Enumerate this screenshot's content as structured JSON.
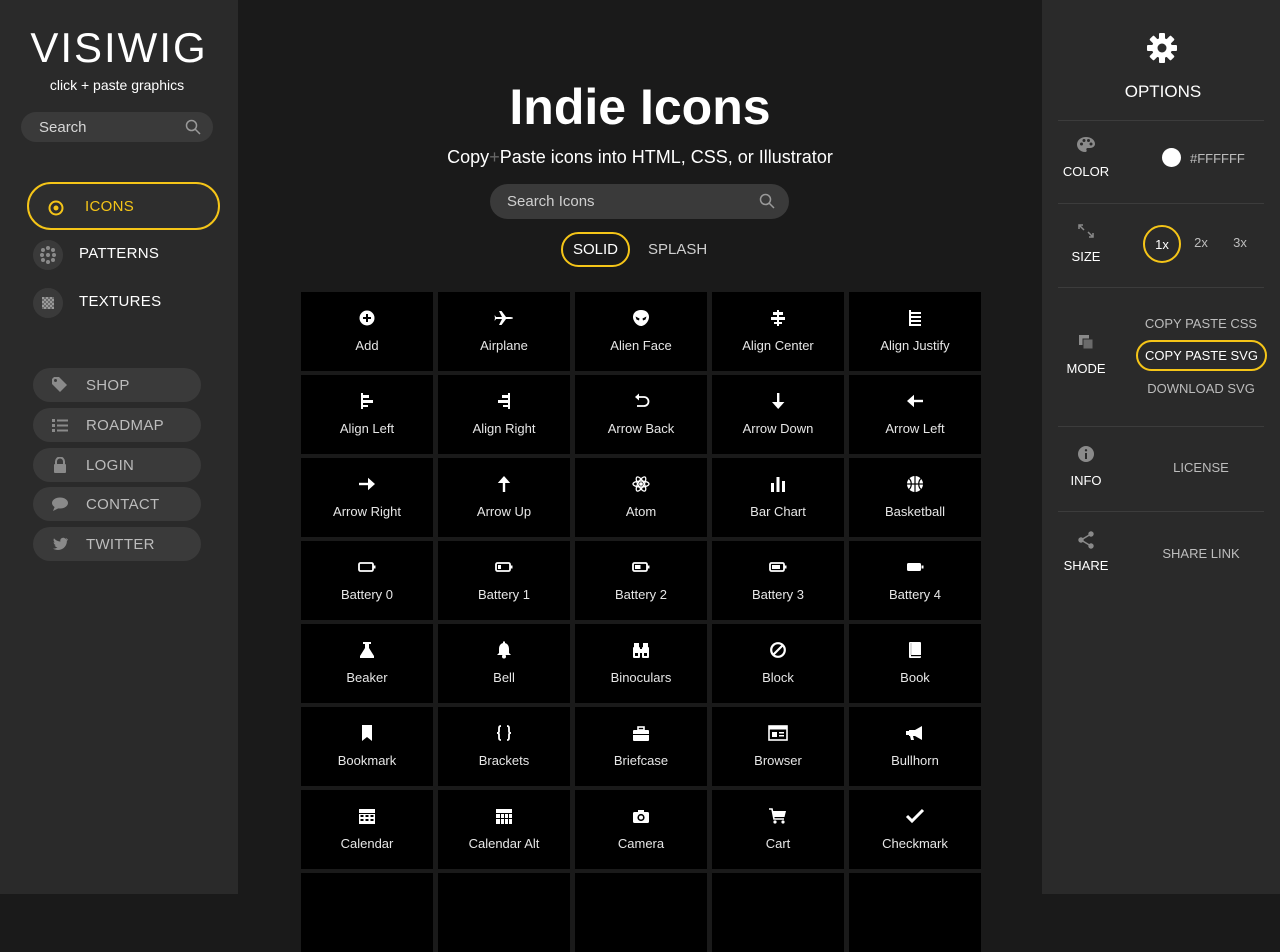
{
  "sidebar": {
    "logo": "VISIWIG",
    "tagline": "click + paste graphics",
    "search_placeholder": "Search",
    "nav": [
      {
        "label": "ICONS",
        "active": true
      },
      {
        "label": "PATTERNS",
        "active": false
      },
      {
        "label": "TEXTURES",
        "active": false
      }
    ],
    "links": [
      {
        "label": "SHOP",
        "icon": "tag-icon"
      },
      {
        "label": "ROADMAP",
        "icon": "list-icon"
      },
      {
        "label": "LOGIN",
        "icon": "lock-icon"
      },
      {
        "label": "CONTACT",
        "icon": "chat-icon"
      },
      {
        "label": "TWITTER",
        "icon": "twitter-icon"
      }
    ]
  },
  "main": {
    "title": "Indie Icons",
    "subtitle_pre": "Copy",
    "subtitle_plus": "+",
    "subtitle_post": "Paste icons into HTML, CSS, or Illustrator",
    "search_placeholder": "Search Icons",
    "tabs": [
      {
        "label": "SOLID",
        "active": true
      },
      {
        "label": "SPLASH",
        "active": false
      }
    ],
    "icons": [
      {
        "label": "Add",
        "icon": "plus-circle-icon"
      },
      {
        "label": "Airplane",
        "icon": "airplane-icon"
      },
      {
        "label": "Alien Face",
        "icon": "alien-face-icon"
      },
      {
        "label": "Align Center",
        "icon": "align-center-icon"
      },
      {
        "label": "Align Justify",
        "icon": "align-justify-icon"
      },
      {
        "label": "Align Left",
        "icon": "align-left-icon"
      },
      {
        "label": "Align Right",
        "icon": "align-right-icon"
      },
      {
        "label": "Arrow Back",
        "icon": "arrow-back-icon"
      },
      {
        "label": "Arrow Down",
        "icon": "arrow-down-icon"
      },
      {
        "label": "Arrow Left",
        "icon": "arrow-left-icon"
      },
      {
        "label": "Arrow Right",
        "icon": "arrow-right-icon"
      },
      {
        "label": "Arrow Up",
        "icon": "arrow-up-icon"
      },
      {
        "label": "Atom",
        "icon": "atom-icon"
      },
      {
        "label": "Bar Chart",
        "icon": "bar-chart-icon"
      },
      {
        "label": "Basketball",
        "icon": "basketball-icon"
      },
      {
        "label": "Battery 0",
        "icon": "battery-0-icon"
      },
      {
        "label": "Battery 1",
        "icon": "battery-1-icon"
      },
      {
        "label": "Battery 2",
        "icon": "battery-2-icon"
      },
      {
        "label": "Battery 3",
        "icon": "battery-3-icon"
      },
      {
        "label": "Battery 4",
        "icon": "battery-4-icon"
      },
      {
        "label": "Beaker",
        "icon": "beaker-icon"
      },
      {
        "label": "Bell",
        "icon": "bell-icon"
      },
      {
        "label": "Binoculars",
        "icon": "binoculars-icon"
      },
      {
        "label": "Block",
        "icon": "block-icon"
      },
      {
        "label": "Book",
        "icon": "book-icon"
      },
      {
        "label": "Bookmark",
        "icon": "bookmark-icon"
      },
      {
        "label": "Brackets",
        "icon": "brackets-icon"
      },
      {
        "label": "Briefcase",
        "icon": "briefcase-icon"
      },
      {
        "label": "Browser",
        "icon": "browser-icon"
      },
      {
        "label": "Bullhorn",
        "icon": "bullhorn-icon"
      },
      {
        "label": "Calendar",
        "icon": "calendar-icon"
      },
      {
        "label": "Calendar Alt",
        "icon": "calendar-alt-icon"
      },
      {
        "label": "Camera",
        "icon": "camera-icon"
      },
      {
        "label": "Cart",
        "icon": "cart-icon"
      },
      {
        "label": "Checkmark",
        "icon": "checkmark-icon"
      }
    ]
  },
  "options": {
    "title": "OPTIONS",
    "color_label": "COLOR",
    "color_value": "#FFFFFF",
    "size_label": "SIZE",
    "sizes": [
      {
        "label": "1x",
        "active": true
      },
      {
        "label": "2x",
        "active": false
      },
      {
        "label": "3x",
        "active": false
      }
    ],
    "mode_label": "MODE",
    "modes": [
      {
        "label": "COPY PASTE CSS",
        "active": false
      },
      {
        "label": "COPY PASTE SVG",
        "active": true
      },
      {
        "label": "DOWNLOAD SVG",
        "active": false
      }
    ],
    "info_label": "INFO",
    "license_label": "LICENSE",
    "share_label": "SHARE",
    "share_link_label": "SHARE LINK"
  },
  "colors": {
    "accent": "#f5c518",
    "sidebar_bg": "#2a2a2a",
    "main_bg": "#1a1a1a",
    "tile_bg": "#000000"
  }
}
